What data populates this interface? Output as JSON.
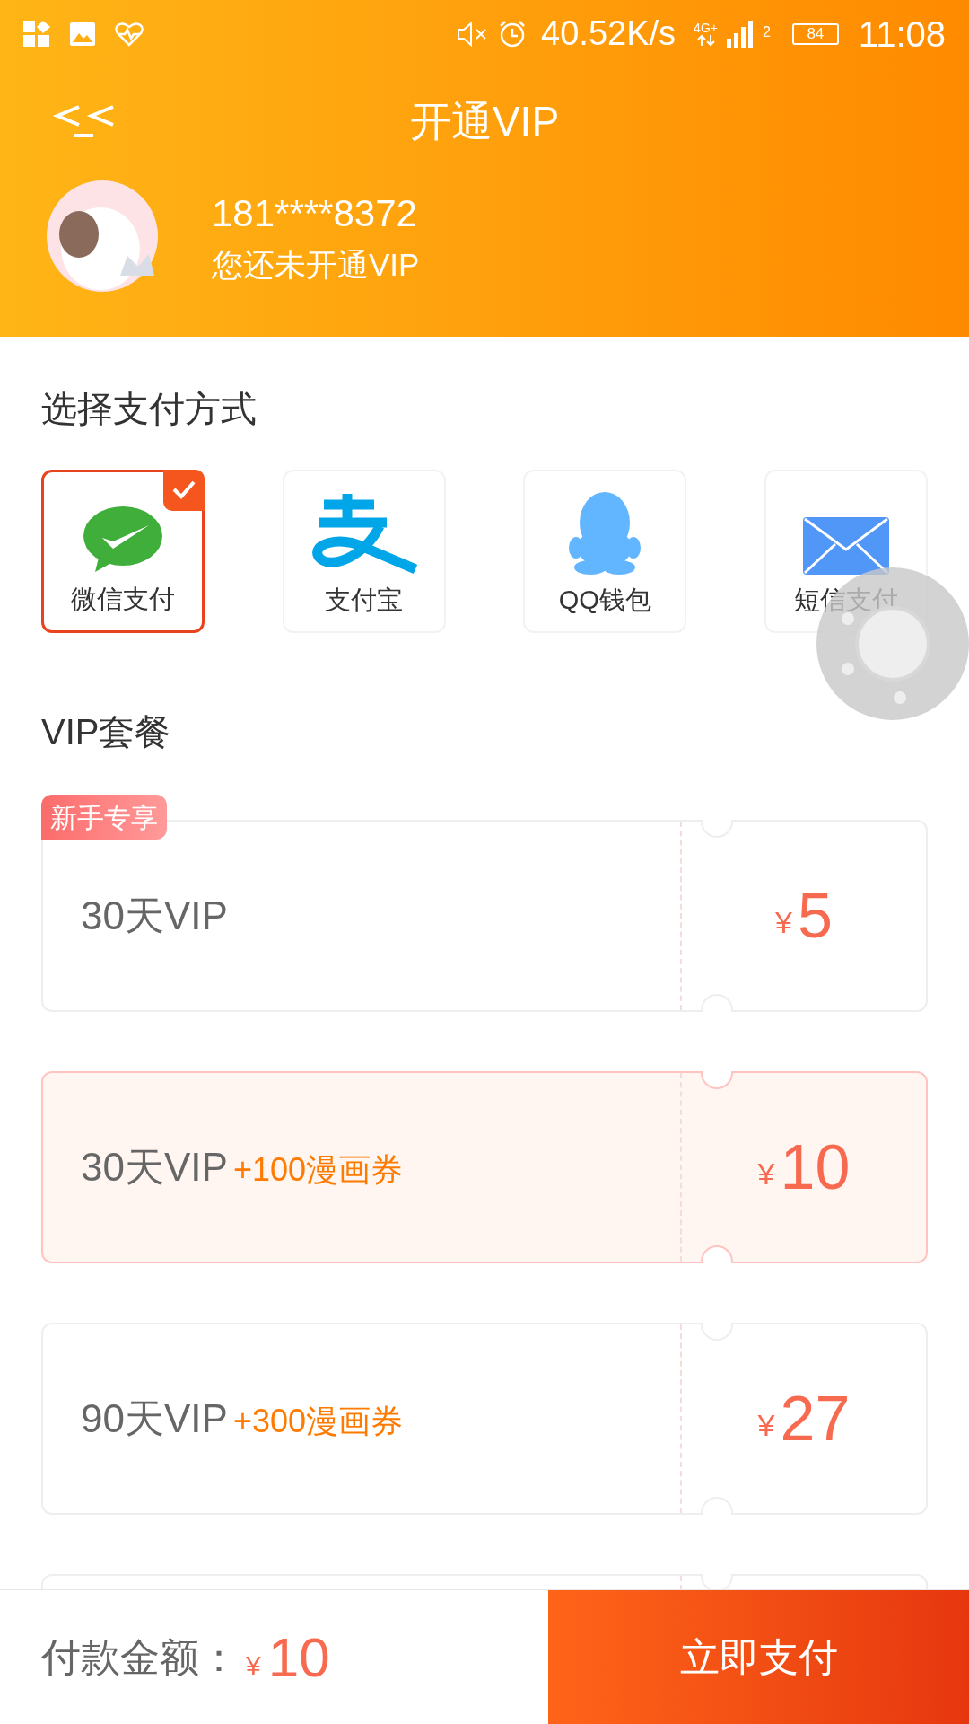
{
  "status_bar": {
    "speed": "40.52K/s",
    "network": "4G+",
    "sim": "2",
    "battery": "84",
    "time": "11:08"
  },
  "header": {
    "title": "开通VIP",
    "phone": "181****8372",
    "vip_status": "您还未开通VIP"
  },
  "payment": {
    "heading": "选择支付方式",
    "methods": [
      {
        "kind": "wechat",
        "label": "微信支付",
        "selected": true
      },
      {
        "kind": "alipay",
        "label": "支付宝",
        "selected": false
      },
      {
        "kind": "qq",
        "label": "QQ钱包",
        "selected": false
      },
      {
        "kind": "sms",
        "label": "短信支付",
        "selected": false
      }
    ]
  },
  "packages": {
    "heading": "VIP套餐",
    "items": [
      {
        "badge": "新手专享",
        "name": "30天VIP",
        "currency": "¥",
        "price": "5",
        "selected": false
      },
      {
        "name": "30天VIP",
        "bonus": "+100漫画券",
        "currency": "¥",
        "price": "10",
        "selected": true
      },
      {
        "name": "90天VIP",
        "bonus": "+300漫画券",
        "currency": "¥",
        "price": "27",
        "selected": false
      },
      {
        "selected": false
      }
    ]
  },
  "footer": {
    "label": "付款金额：",
    "currency": "¥",
    "amount": "10",
    "button": "立即支付"
  }
}
